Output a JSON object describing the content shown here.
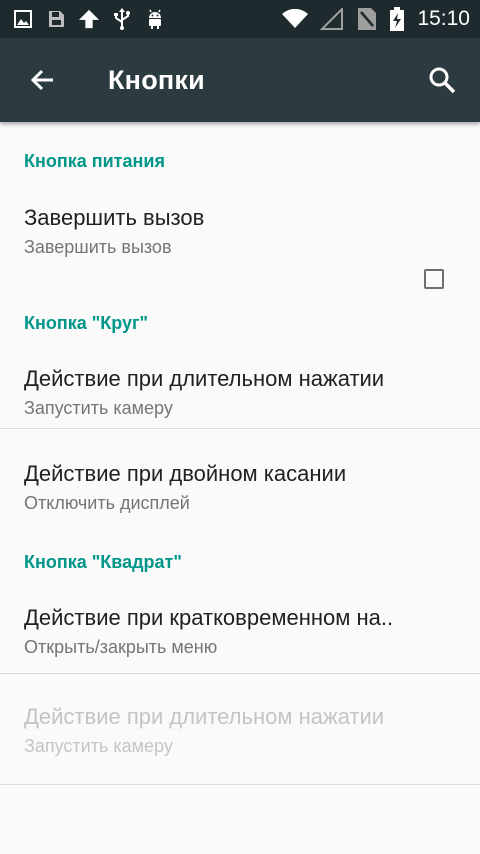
{
  "status_bar": {
    "time": "15:10",
    "icons_left": [
      "image-icon",
      "sd-card-icon",
      "upload-arrow-icon",
      "usb-icon",
      "android-icon"
    ],
    "icons_right": [
      "wifi-icon",
      "signal-empty-icon",
      "no-sim-icon",
      "battery-charging-icon"
    ]
  },
  "app_bar": {
    "title": "Кнопки",
    "back_icon": "arrow-back-icon",
    "search_icon": "search-icon"
  },
  "sections": [
    {
      "header": "Кнопка питания",
      "items": [
        {
          "title": "Завершить вызов",
          "summary": "Завершить вызов",
          "checked": false
        }
      ]
    },
    {
      "header": "Кнопка \"Круг\"",
      "items": [
        {
          "title": "Действие при длительном нажатии",
          "summary": "Запустить камеру"
        },
        {
          "title": "Действие при двойном касании",
          "summary": "Отключить дисплей"
        }
      ]
    },
    {
      "header": "Кнопка \"Квадрат\"",
      "items": [
        {
          "title": "Действие при кратковременном на..",
          "summary": "Открыть/закрыть меню"
        },
        {
          "title": "Действие при длительном нажатии",
          "summary": "Запустить камеру",
          "disabled": true
        }
      ]
    }
  ],
  "colors": {
    "status_bar": "#1e2a2e",
    "app_bar": "#2b3b40",
    "accent": "#009688",
    "background": "#fafafa"
  }
}
